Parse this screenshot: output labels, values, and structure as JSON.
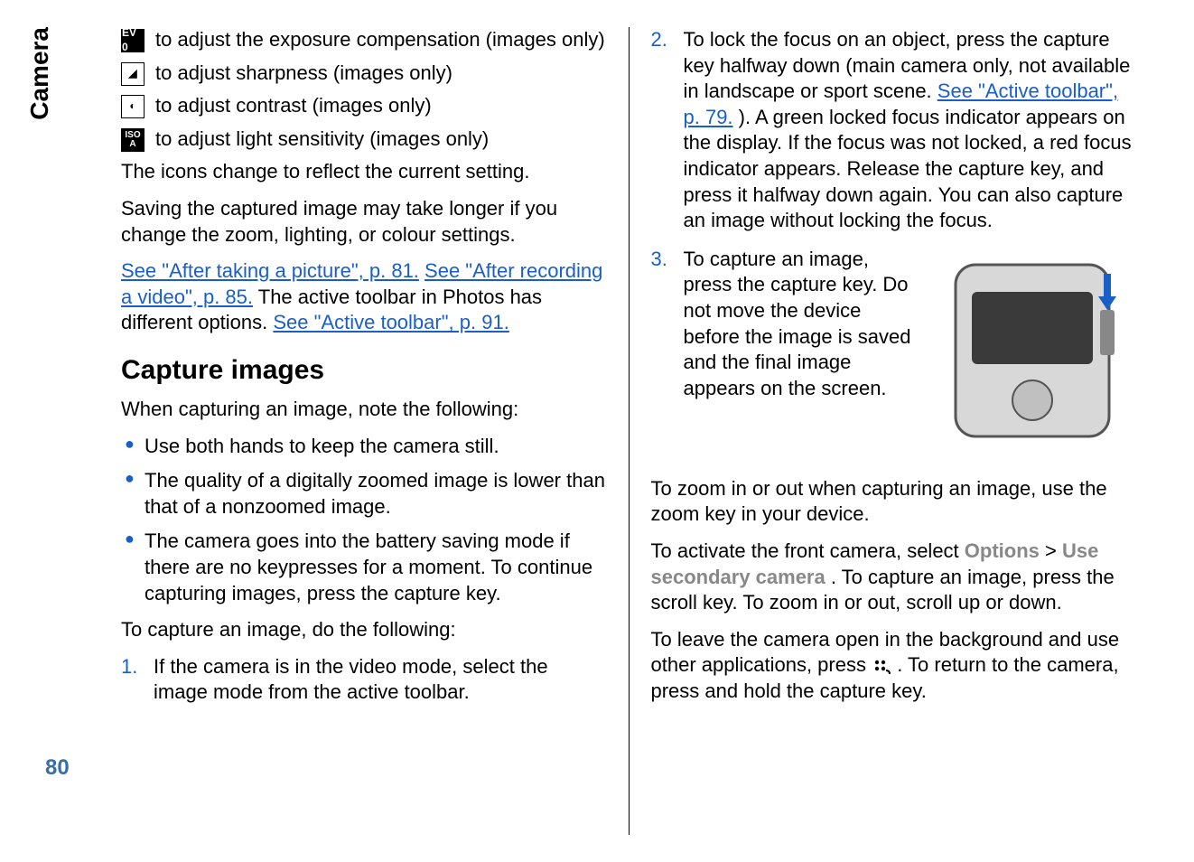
{
  "sideTab": "Camera",
  "pageNumber": "80",
  "left": {
    "iconLines": [
      {
        "iconName": "ev-icon",
        "label": "EV 0",
        "text": " to adjust the exposure compensation (images only)",
        "dark": true
      },
      {
        "iconName": "sharpness-icon",
        "label": "◢",
        "text": " to adjust sharpness (images only)",
        "dark": false
      },
      {
        "iconName": "contrast-icon",
        "label": "◐",
        "text": " to adjust contrast (images only)",
        "dark": false
      },
      {
        "iconName": "iso-icon",
        "label": "ISO A",
        "text": " to adjust light sensitivity (images only)",
        "dark": true
      }
    ],
    "p1": "The icons change to reflect the current setting.",
    "p2": "Saving the captured image may take longer if you change the zoom, lighting, or colour settings.",
    "links": {
      "afterPic": "See \"After taking a picture\", p. 81.",
      "afterVid": "See \"After recording a video\", p. 85.",
      "midText": " The active toolbar in Photos has different options. ",
      "activeToolbar": "See \"Active toolbar\", p. 91."
    },
    "h2": "Capture images",
    "p3": "When capturing an image, note the following:",
    "bullets": [
      "Use both hands to keep the camera still.",
      "The quality of a digitally zoomed image is lower than that of a nonzoomed image.",
      "The camera goes into the battery saving mode if there are no keypresses for a moment. To continue capturing images, press the capture key."
    ],
    "p4": "To capture an image, do the following:",
    "steps": [
      {
        "n": "1.",
        "text": "If the camera is in the video mode, select the image mode from the active toolbar."
      }
    ]
  },
  "right": {
    "steps": [
      {
        "n": "2.",
        "before": "To lock the focus on an object, press the capture key halfway down (main camera only, not available in landscape or sport scene. ",
        "link": "See \"Active toolbar\", p. 79.",
        "after": "). A green locked focus indicator appears on the display. If the focus was not locked, a red focus indicator appears. Release the capture key, and press it halfway down again. You can also capture an image without locking the focus."
      },
      {
        "n": "3.",
        "text": "To capture an image, press the capture key. Do not move the device before the image is saved and the final image appears on the screen."
      }
    ],
    "p1": "To zoom in or out when capturing an image, use the zoom key in your device.",
    "p2a": "To activate the front camera, select ",
    "ui1": "Options",
    "gt": " > ",
    "ui2": "Use secondary camera",
    "p2b": ". To capture an image, press the scroll key. To zoom in or out, scroll up or down.",
    "p3a": "To leave the camera open in the background and use other applications, press ",
    "keyIconName": "menu-key-icon",
    "p3b": " . To return to the camera, press and hold the capture key."
  }
}
